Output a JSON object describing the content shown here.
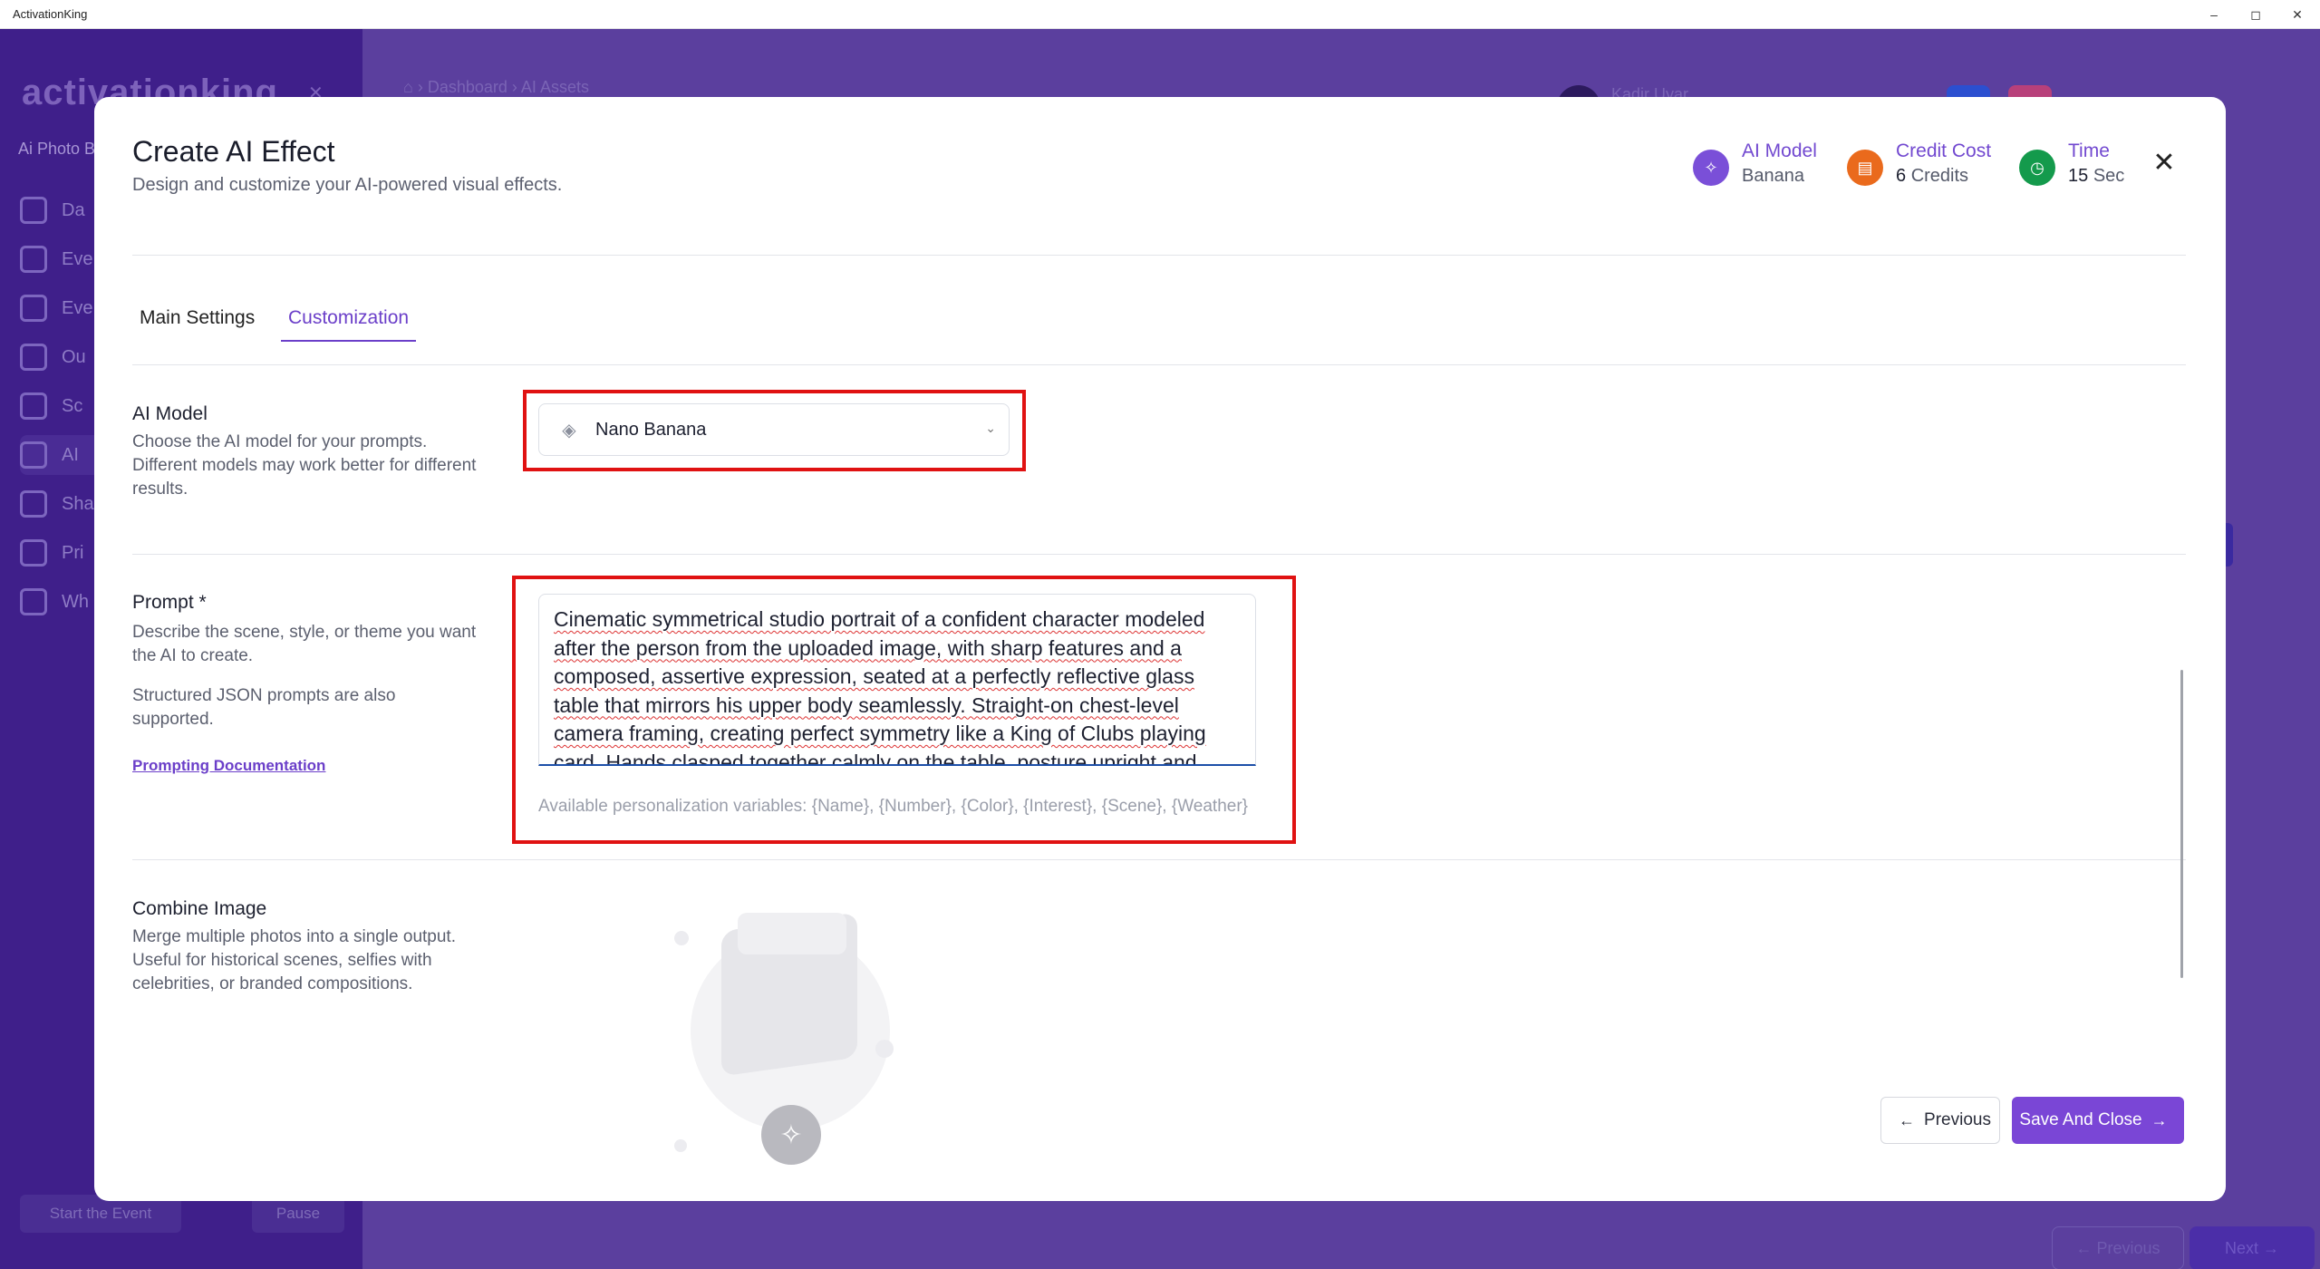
{
  "window": {
    "title": "ActivationKing",
    "minimize": "–",
    "maximize": "◻",
    "close": "✕"
  },
  "background": {
    "logo": "activationking",
    "sidebar_section": "Ai Photo B",
    "nav": [
      "Da",
      "Eve",
      "Eve",
      "Ou",
      "Sc",
      "AI",
      "Sha",
      "Pri",
      "Wh"
    ],
    "start_event": "Start the Event",
    "pause": "Pause",
    "breadcrumb": "⌂  ›  Dashboard  ›  AI Assets",
    "user": "Kadir Uyar",
    "previous": "← Previous",
    "next": "Next →"
  },
  "modal": {
    "title": "Create AI Effect",
    "subtitle": "Design and customize your AI-powered visual effects.",
    "stats": {
      "model_label": "AI Model",
      "model_value": "Banana",
      "cost_label": "Credit Cost",
      "cost_number": "6",
      "cost_unit": "Credits",
      "time_label": "Time",
      "time_number": "15",
      "time_unit": "Sec"
    },
    "close_icon": "✕",
    "tabs": [
      {
        "label": "Main Settings",
        "active": false
      },
      {
        "label": "Customization",
        "active": true
      }
    ],
    "ai_model": {
      "title": "AI Model",
      "description": "Choose the AI model for your prompts. Different models may work better for different results.",
      "selected": "Nano Banana",
      "icon": "diamond-icon"
    },
    "prompt": {
      "title": "Prompt *",
      "description": "Describe the scene, style, or theme you want the AI to create.",
      "json_note": "Structured JSON prompts are also supported.",
      "doc_link": "Prompting Documentation",
      "value": "Cinematic symmetrical studio portrait of a confident character modeled after the person from the uploaded image, with sharp features and a composed, assertive expression, seated at a perfectly reflective glass table that mirrors his upper body seamlessly. Straight-on chest-level camera framing, creating perfect symmetry like a King of Clubs playing card. Hands clasped together calmly on the table, posture upright and self-",
      "variables_hint": "Available personalization variables: {Name}, {Number}, {Color}, {Interest}, {Scene}, {Weather}"
    },
    "combine_image": {
      "title": "Combine Image",
      "description": "Merge multiple photos into a single output. Useful for historical scenes, selfies with celebrities, or branded compositions."
    },
    "buttons": {
      "previous": "Previous",
      "save": "Save And Close"
    }
  },
  "colors": {
    "accent": "#7a46d6",
    "highlight": "#e01212",
    "cost": "#ea6a1c",
    "time": "#149a4c"
  }
}
